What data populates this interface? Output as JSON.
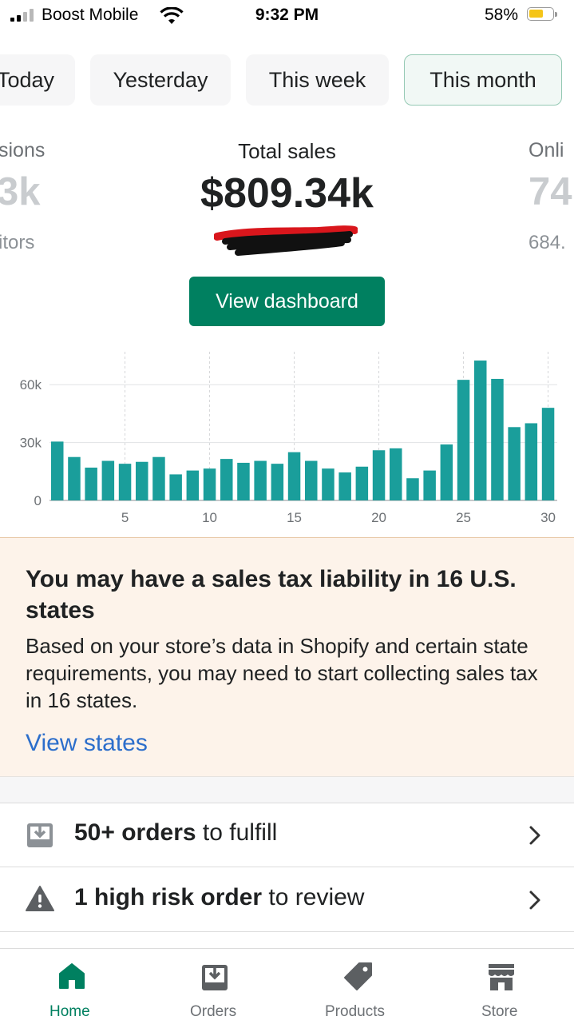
{
  "status_bar": {
    "carrier": "Boost Mobile",
    "time": "9:32 PM",
    "battery": "58%"
  },
  "periods": [
    {
      "label": "Today",
      "selected": false
    },
    {
      "label": "Yesterday",
      "selected": false
    },
    {
      "label": "This week",
      "selected": false
    },
    {
      "label": "This month",
      "selected": true
    }
  ],
  "metrics": {
    "left": {
      "label": "sions",
      "value": "3k",
      "sub": "itors"
    },
    "center": {
      "label": "Total sales",
      "value": "$809.34k"
    },
    "right": {
      "label": "Onli",
      "value": "74",
      "sub": "684."
    }
  },
  "dashboard_button": "View dashboard",
  "chart_data": {
    "type": "bar",
    "x": [
      1,
      2,
      3,
      4,
      5,
      6,
      7,
      8,
      9,
      10,
      11,
      12,
      13,
      14,
      15,
      16,
      17,
      18,
      19,
      20,
      21,
      22,
      23,
      24,
      25,
      26,
      27,
      28,
      29,
      30
    ],
    "values": [
      30500,
      22500,
      17000,
      20500,
      19000,
      20000,
      22500,
      13500,
      15500,
      16500,
      21500,
      19500,
      20500,
      19000,
      25000,
      20500,
      16500,
      14500,
      17500,
      26000,
      27000,
      11500,
      15500,
      29000,
      62500,
      72500,
      63000,
      38000,
      40000,
      48000
    ],
    "xticks": [
      "5",
      "10",
      "15",
      "20",
      "25",
      "30"
    ],
    "xtick_values": [
      5,
      10,
      15,
      20,
      25,
      30
    ],
    "yticks": [
      "0",
      "30k",
      "60k"
    ],
    "ytick_values": [
      0,
      30000,
      60000
    ],
    "ylim": [
      0,
      75000
    ],
    "grid": true,
    "color": "#1a9e9b"
  },
  "banner": {
    "title": "You may have a sales tax liability in 16 U.S. states",
    "body": "Based on your store’s data in Shopify and certain state requirements, you may need to start collecting sales tax in 16 states.",
    "link": "View states"
  },
  "tasks": [
    {
      "bold": "50+ orders",
      "rest": " to fulfill",
      "icon": "inbox-download-icon"
    },
    {
      "bold": "1 high risk order",
      "rest": " to review",
      "icon": "warning-icon"
    }
  ],
  "tabs": [
    {
      "label": "Home",
      "icon": "home-icon",
      "active": true
    },
    {
      "label": "Orders",
      "icon": "orders-icon",
      "active": false
    },
    {
      "label": "Products",
      "icon": "tag-icon",
      "active": false
    },
    {
      "label": "Store",
      "icon": "store-icon",
      "active": false
    }
  ],
  "colors": {
    "brand_green": "#008060",
    "link_blue": "#2c6ecb",
    "banner_bg": "#fdf3ea",
    "bar_teal": "#1a9e9b"
  }
}
